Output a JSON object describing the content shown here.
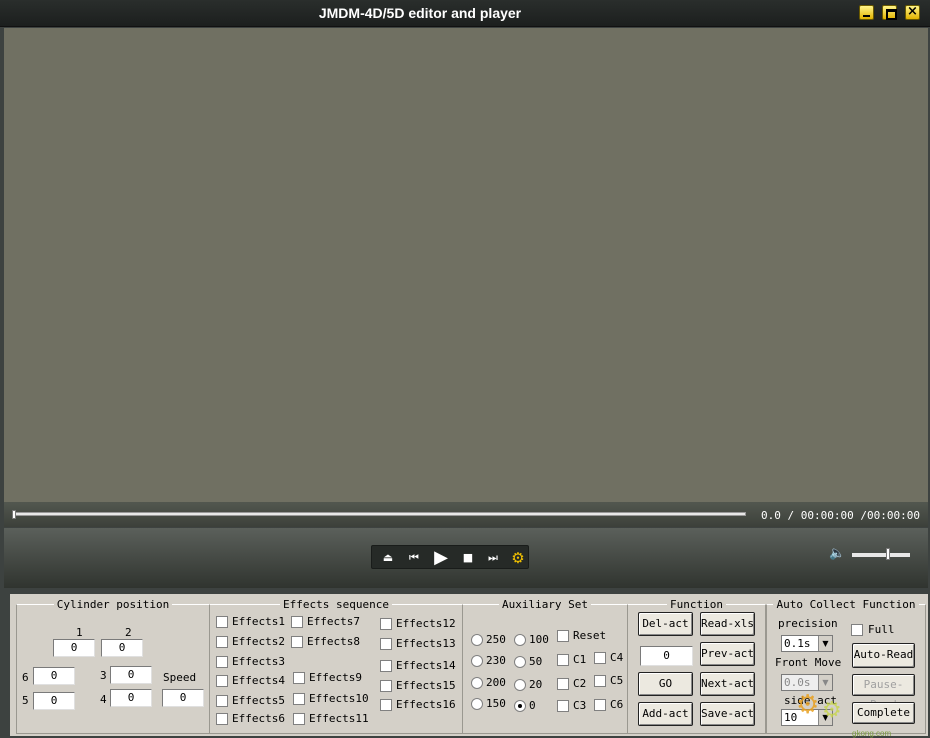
{
  "window": {
    "title": "JMDM-4D/5D editor and player"
  },
  "seek": {
    "time": "0.0 / 00:00:00 /00:00:00"
  },
  "cylinder": {
    "legend": "Cylinder position",
    "labels": {
      "c1": "1",
      "c2": "2",
      "c3": "3",
      "c4": "4",
      "c5": "5",
      "c6": "6",
      "speed": "Speed"
    },
    "values": {
      "c1": "0",
      "c2": "0",
      "c3": "0",
      "c4": "0",
      "c5": "0",
      "c6": "0",
      "speed": "0"
    }
  },
  "effects": {
    "legend": "Effects sequence",
    "items": [
      "Effects1",
      "Effects2",
      "Effects3",
      "Effects4",
      "Effects5",
      "Effects6",
      "Effects7",
      "Effects8",
      "Effects9",
      "Effects10",
      "Effects11",
      "Effects12",
      "Effects13",
      "Effects14",
      "Effects15",
      "Effects16"
    ]
  },
  "auxiliary": {
    "legend": "Auxiliary Set",
    "radios": [
      "250",
      "230",
      "200",
      "150",
      "100",
      "50",
      "20",
      "0"
    ],
    "selected": "0",
    "checks": [
      "Reset",
      "C1",
      "C2",
      "C3",
      "C4",
      "C5",
      "C6"
    ]
  },
  "function": {
    "legend": "Function",
    "del": "Del-act",
    "read": "Read-xls",
    "num": "0",
    "prev": "Prev-act",
    "go": "GO",
    "next": "Next-act",
    "add": "Add-act",
    "save": "Save-act"
  },
  "auto": {
    "legend": "Auto Collect Function",
    "precision_label": "precision",
    "precision_value": "0.1s",
    "full": "Full",
    "front_label": "Front Move",
    "front_value": "0.0s",
    "side_label": "side act",
    "side_value": "10",
    "auto_read": "Auto-Read",
    "pause_read": "Pause-Read",
    "complete": "Complete"
  },
  "watermark": {
    "text": "gkong.com"
  }
}
